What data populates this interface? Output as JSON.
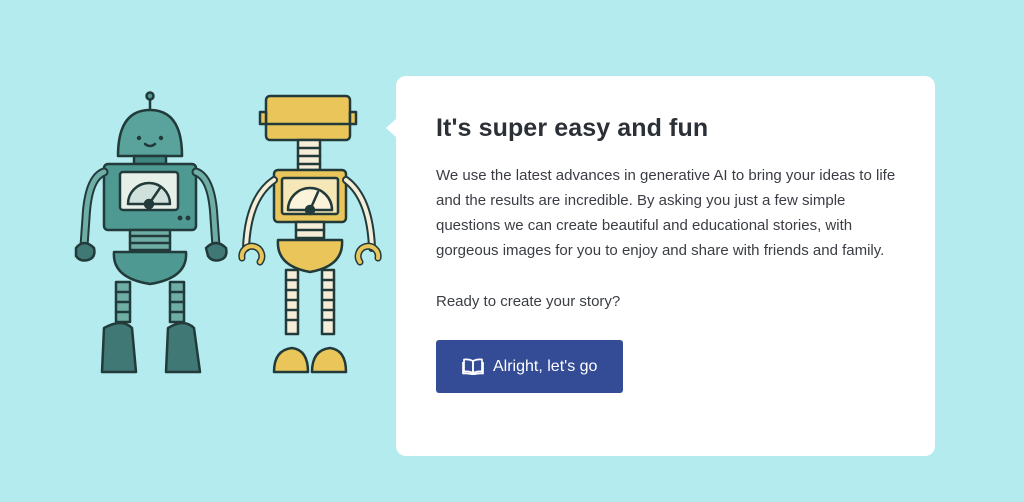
{
  "card": {
    "title": "It's super easy and fun",
    "body": "We use the latest advances in generative AI to bring your ideas to life and the results are incredible. By asking you just a few simple questions we can create beautiful and educational stories, with gorgeous images for you to enjoy and share with friends and family.",
    "question": "Ready to create your story?",
    "cta_label": "Alright, let's go",
    "cta_icon": "book-open-icon"
  },
  "colors": {
    "background": "#b3ebee",
    "card": "#ffffff",
    "button": "#344b95",
    "robot_teal": "#4e9a93",
    "robot_yellow": "#eac65a"
  }
}
